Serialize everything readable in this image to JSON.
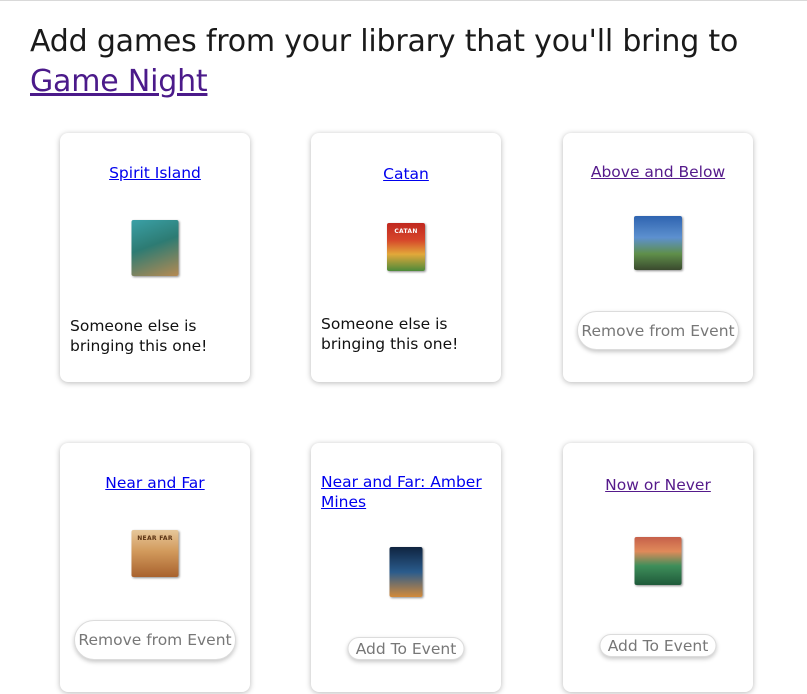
{
  "header": {
    "prefix": "Add games from your library that you'll bring to",
    "event_link": "Game Night"
  },
  "games": [
    {
      "title": "Spirit Island",
      "note": "Someone else is bringing this one!",
      "cover_color": "#3f8f8c"
    },
    {
      "title": "Catan",
      "note": "Someone else is bringing this one!",
      "cover_color": "#c0281f",
      "cover_text": "CATAN"
    },
    {
      "title": "Above and Below",
      "button": "Remove from Event",
      "cover_color": "#3e6fae"
    },
    {
      "title": "Near and Far",
      "button": "Remove from Event",
      "cover_color": "#c98b4a",
      "cover_text": "NEAR FAR"
    },
    {
      "title": "Near and Far: Amber Mines",
      "button": "Add To Event",
      "cover_color": "#1f3f66"
    },
    {
      "title": "Now or Never",
      "button": "Add To Event",
      "cover_color": "#2f8a57"
    }
  ]
}
